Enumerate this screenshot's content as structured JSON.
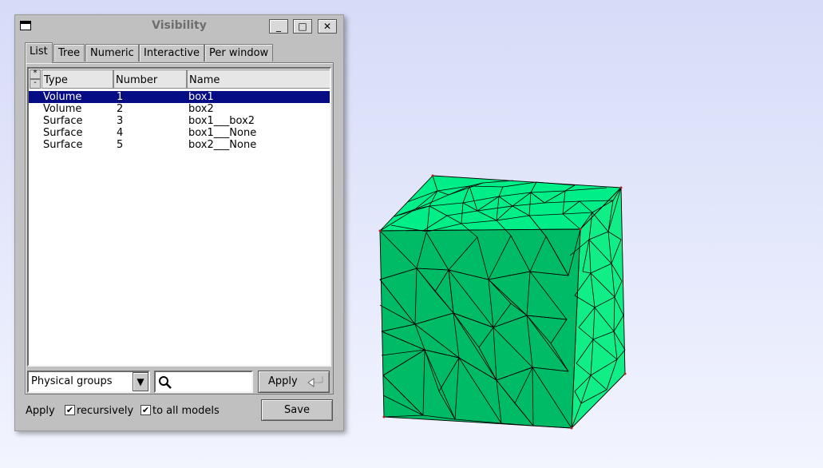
{
  "window": {
    "title": "Visibility",
    "controls": {
      "minimize": "_",
      "maximize": "□",
      "close": "✕"
    }
  },
  "tabs": [
    "List",
    "Tree",
    "Numeric",
    "Interactive",
    "Per window"
  ],
  "list": {
    "select_all": "*",
    "select_none": "-",
    "columns": [
      "Type",
      "Number",
      "Name"
    ],
    "rows": [
      {
        "type": "Volume",
        "number": "1",
        "name": "box1",
        "selected": true
      },
      {
        "type": "Volume",
        "number": "2",
        "name": "box2",
        "selected": false
      },
      {
        "type": "Surface",
        "number": "3",
        "name": "box1___box2",
        "selected": false
      },
      {
        "type": "Surface",
        "number": "4",
        "name": "box1___None",
        "selected": false
      },
      {
        "type": "Surface",
        "number": "5",
        "name": "box2___None",
        "selected": false
      }
    ]
  },
  "controls": {
    "mode_select": "Physical groups",
    "search_value": "",
    "apply_label": "Apply"
  },
  "footer": {
    "apply_text": "Apply",
    "recursively_label": "recursively",
    "recursively_checked": true,
    "all_models_label": "to all models",
    "all_models_checked": true,
    "save_label": "Save"
  },
  "icons": {
    "system_menu": "window-menu-icon",
    "dropdown": "triangle-down-icon",
    "search": "magnifier-icon",
    "apply_return": "return-arrow-icon",
    "check": "checkmark-icon"
  },
  "colors": {
    "selection_bg": "#050c84",
    "mesh_front": "#00bb66",
    "mesh_top": "#00ee88",
    "mesh_side": "#11ee88"
  }
}
